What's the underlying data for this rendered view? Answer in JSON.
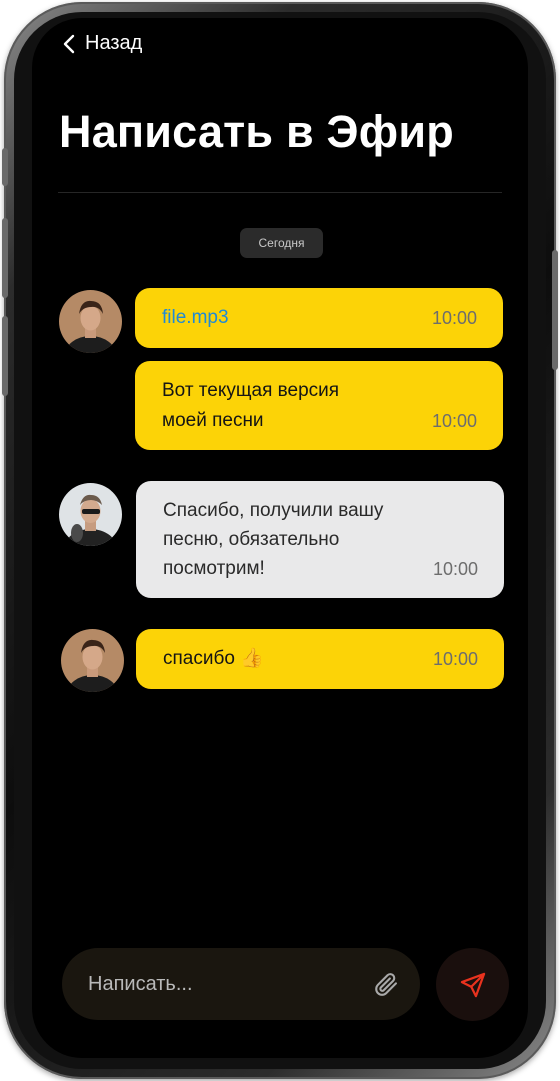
{
  "header": {
    "back_label": "Назад",
    "title": "Написать в Эфир"
  },
  "date_separator": "Сегодня",
  "messages": [
    {
      "sender": "user",
      "text": "file.mp3",
      "time": "10:00",
      "type": "file"
    },
    {
      "sender": "user",
      "text_lines": [
        "Вот текущая версия",
        "моей песни"
      ],
      "time": "10:00",
      "type": "text"
    },
    {
      "sender": "station",
      "text_lines": [
        "Спасибо, получили вашу",
        "песню, обязательно",
        "посмотрим!"
      ],
      "time": "10:00",
      "type": "text"
    },
    {
      "sender": "user",
      "text": "спасибо 👍",
      "time": "10:00",
      "type": "text"
    }
  ],
  "composer": {
    "placeholder": "Написать...",
    "attach_icon": "paperclip-icon",
    "send_icon": "send-icon"
  },
  "colors": {
    "background": "#000000",
    "user_bubble": "#fcd307",
    "station_bubble": "#e9e9ea",
    "link": "#1f8ad6",
    "send_accent": "#e8321e"
  }
}
